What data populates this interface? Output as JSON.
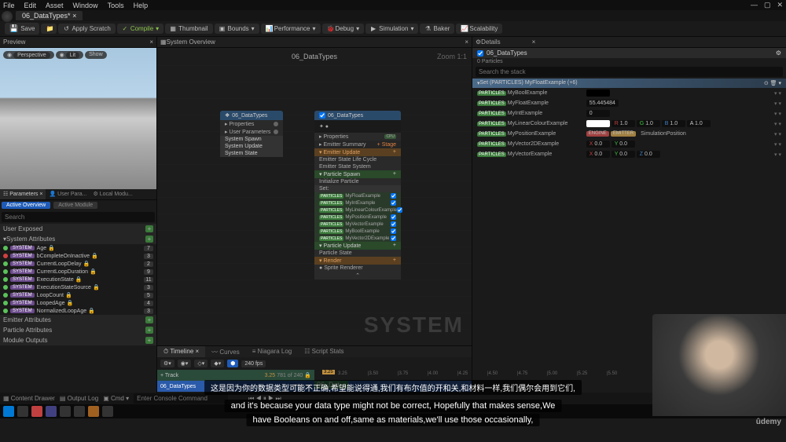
{
  "menubar": {
    "file": "File",
    "edit": "Edit",
    "asset": "Asset",
    "window": "Window",
    "tools": "Tools",
    "help": "Help"
  },
  "doc_tab": "06_DataTypes*",
  "toolbar": {
    "save": "Save",
    "browse": "",
    "apply": "Apply Scratch",
    "compile": "Compile",
    "thumbnail": "Thumbnail",
    "bounds": "Bounds",
    "performance": "Performance",
    "debug": "Debug",
    "simulation": "Simulation",
    "baker": "Baker",
    "scalability": "Scalability"
  },
  "preview": {
    "title": "Preview",
    "ctrl": {
      "perspective": "Perspective",
      "lit": "Lit",
      "show": "Show"
    }
  },
  "params": {
    "tabs": {
      "parameters": "Parameters",
      "userparams": "User Para...",
      "localmod": "Local Modu..."
    },
    "active_overview": "Active Overview",
    "active_module": "Active Module",
    "search_placeholder": "Search",
    "user_exposed": "User Exposed",
    "system_attributes": "System Attributes",
    "emitter_attributes": "Emitter Attributes",
    "particle_attributes": "Particle Attributes",
    "module_outputs": "Module Outputs",
    "sys_rows": [
      {
        "name": "Age",
        "n": "7"
      },
      {
        "name": "bCompleteOnInactive",
        "n": "3",
        "red": true
      },
      {
        "name": "CurrentLoopDelay",
        "n": "2"
      },
      {
        "name": "CurrentLoopDuration",
        "n": "9"
      },
      {
        "name": "ExecutionState",
        "n": "11"
      },
      {
        "name": "ExecutionStateSource",
        "n": "3"
      },
      {
        "name": "LoopCount",
        "n": "5"
      },
      {
        "name": "LoopedAge",
        "n": "4"
      },
      {
        "name": "NormalizedLoopAge",
        "n": "3"
      }
    ],
    "badge": "SYSTEM"
  },
  "graph": {
    "overview_tab": "System Overview",
    "title": "06_DataTypes",
    "zoom": "Zoom 1:1",
    "watermark": "SYSTEM",
    "node1": {
      "title": "06_DataTypes",
      "rows": [
        "Properties",
        "User Parameters",
        "System Spawn",
        "System Update",
        "System State"
      ]
    },
    "node2": {
      "title": "06_DataTypes",
      "props": "Properties",
      "summary": "Emitter Summary",
      "stage": "+  Stage",
      "eu": "Emitter Update",
      "esl": "Emitter State Life Cycle",
      "es": "Emitter State System",
      "ps": "Particle Spawn",
      "ip": "Initialize Particle",
      "set": "Set:",
      "myrows": [
        "MyFloatExample",
        "MyIntExample",
        "MyLinearColourExample",
        "MyPositionExample",
        "MyVectorExample",
        "MyBoolExample",
        "MyVector2DExample"
      ],
      "pu": "Particle Update",
      "pstate": "Particle State",
      "render": "Render",
      "sprite": "Sprite Renderer",
      "par_badge": "PARTICLES"
    }
  },
  "timeline": {
    "tabs": {
      "timeline": "Timeline",
      "curves": "Curves",
      "niagara": "Niagara Log",
      "script": "Script Stats"
    },
    "fps": "240 fps",
    "track_btn": "+ Track",
    "cur": "3.25",
    "range": "781 of 240",
    "row": "06_DataTypes",
    "clip": "06_Dat...",
    "ticks": [
      "3.25",
      "|3.50",
      "|3.75",
      "|4.00",
      "|4.25",
      "|4.50",
      "|4.75",
      "|5.00",
      "|5.25",
      "|5.50"
    ],
    "marker": "3.25"
  },
  "details": {
    "title": "Details",
    "name": "06_DataTypes",
    "particles": "0 Particles",
    "search_placeholder": "Search the stack",
    "cat": "Set (PARTICLES) MyFloatExample (+6)",
    "par_badge": "PARTICLES",
    "rows": [
      {
        "label": "MyBoolExample",
        "val": {
          "swatch": true
        }
      },
      {
        "label": "MyFloatExample",
        "val": {
          "num": "55.445484"
        }
      },
      {
        "label": "MyIntExample",
        "val": {
          "num": "0"
        }
      },
      {
        "label": "MyLinearColourExample",
        "val": {
          "rgba": [
            "1.0",
            "1.0",
            "1.0",
            "1.0"
          ]
        }
      },
      {
        "label": "MyPositionExample",
        "val": {
          "tags": [
            "ENGINE",
            "EMITTER"
          ],
          "text": "SimulationPosition"
        }
      },
      {
        "label": "MyVector2DExample",
        "val": {
          "xy": [
            "0.0",
            "0.0"
          ]
        }
      },
      {
        "label": "MyVectorExample",
        "val": {
          "xyz": [
            "0.0",
            "0.0",
            "0.0"
          ]
        }
      }
    ]
  },
  "status": {
    "content": "Content Drawer",
    "output": "Output Log",
    "cmd": "Cmd",
    "console": "Enter Console Command"
  },
  "subtitles": {
    "cn": "这是因为你的数据类型可能不正确,希望能说得通,我们有布尔值的开和关,和材料一样,我们偶尔会用到它们,",
    "en1": "and it's because your data type might not be correct, Hopefully that makes sense,We",
    "en2": "have Booleans on and off,same as materials,we'll use those occasionally,"
  },
  "udemy": "ûdemy"
}
